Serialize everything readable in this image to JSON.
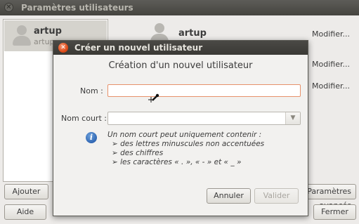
{
  "background_window": {
    "title": "Paramètres utilisateurs",
    "user_list": [
      {
        "name": "artup",
        "subtitle": "artup"
      }
    ],
    "detail_name": "artup",
    "modify_links": [
      "Modifier...",
      "Modifier...",
      "Modifier..."
    ],
    "buttons": {
      "add": "Ajouter",
      "help": "Aide",
      "advanced": "Paramètres avancés",
      "close": "Fermer"
    }
  },
  "dialog": {
    "title": "Créer un nouvel utilisateur",
    "heading": "Création d'un nouvel utilisateur",
    "name_label": "Nom :",
    "name_value": "",
    "short_name_label": "Nom court :",
    "short_name_value": "",
    "info_intro": "Un nom court peut uniquement contenir :",
    "info_items": [
      "➢ des lettres minuscules non accentuées",
      "➢ des chiffres",
      "➢ les caractères « . », « - » et « _ »"
    ],
    "cancel_label": "Annuler",
    "validate_label": "Valider",
    "validate_enabled": false
  },
  "icons": {
    "window_close": "close-icon",
    "dialog_close": "close-icon",
    "info": "info-icon",
    "avatar": "user-avatar-icon",
    "dropdown": "chevron-down-icon",
    "cursor": "pen-cursor-icon"
  },
  "colors": {
    "titlebar": "#45443f",
    "dialog_close": "#df4b18",
    "input_focus_border": "#e7916a",
    "info_blue": "#2f66b3"
  }
}
